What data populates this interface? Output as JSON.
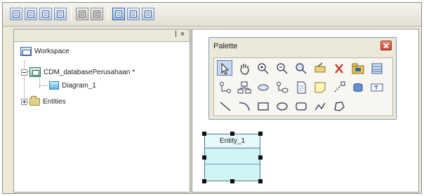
{
  "toolbar": {
    "buttons": [
      "new-model-icon",
      "open-model-icon",
      "save-model-icon",
      "save-all-icon",
      "print-icon",
      "print-preview-icon",
      "pointer-tool-icon",
      "palette-icon",
      "workspace-icon"
    ]
  },
  "workspace": {
    "pin_glyph": "ꟾ",
    "close_glyph": "×",
    "tree": {
      "root": "Workspace",
      "model": "CDM_databasePerusahaan *",
      "diagram": "Diagram_1",
      "folder": "Entities"
    }
  },
  "palette": {
    "title": "Palette",
    "tools": [
      "pointer-tool",
      "grabber-tool",
      "zoom-in-tool",
      "zoom-out-tool",
      "open-view-tool",
      "properties-tool",
      "delete-tool",
      "package-tool",
      "entity-tool",
      "inheritance-tool",
      "relationship-tool",
      "association-tool",
      "association-link-tool",
      "file-tool",
      "note-tool",
      "link-tool",
      "database-tool",
      "title-tool",
      "line-tool",
      "arc-tool",
      "rectangle-tool",
      "ellipse-tool",
      "rounded-rectangle-tool",
      "polyline-tool",
      "polygon-tool"
    ]
  },
  "entity": {
    "name": "Entity_1"
  },
  "colors": {
    "entity_fill": "#cff5f7",
    "palette_close": "#c7412c"
  }
}
